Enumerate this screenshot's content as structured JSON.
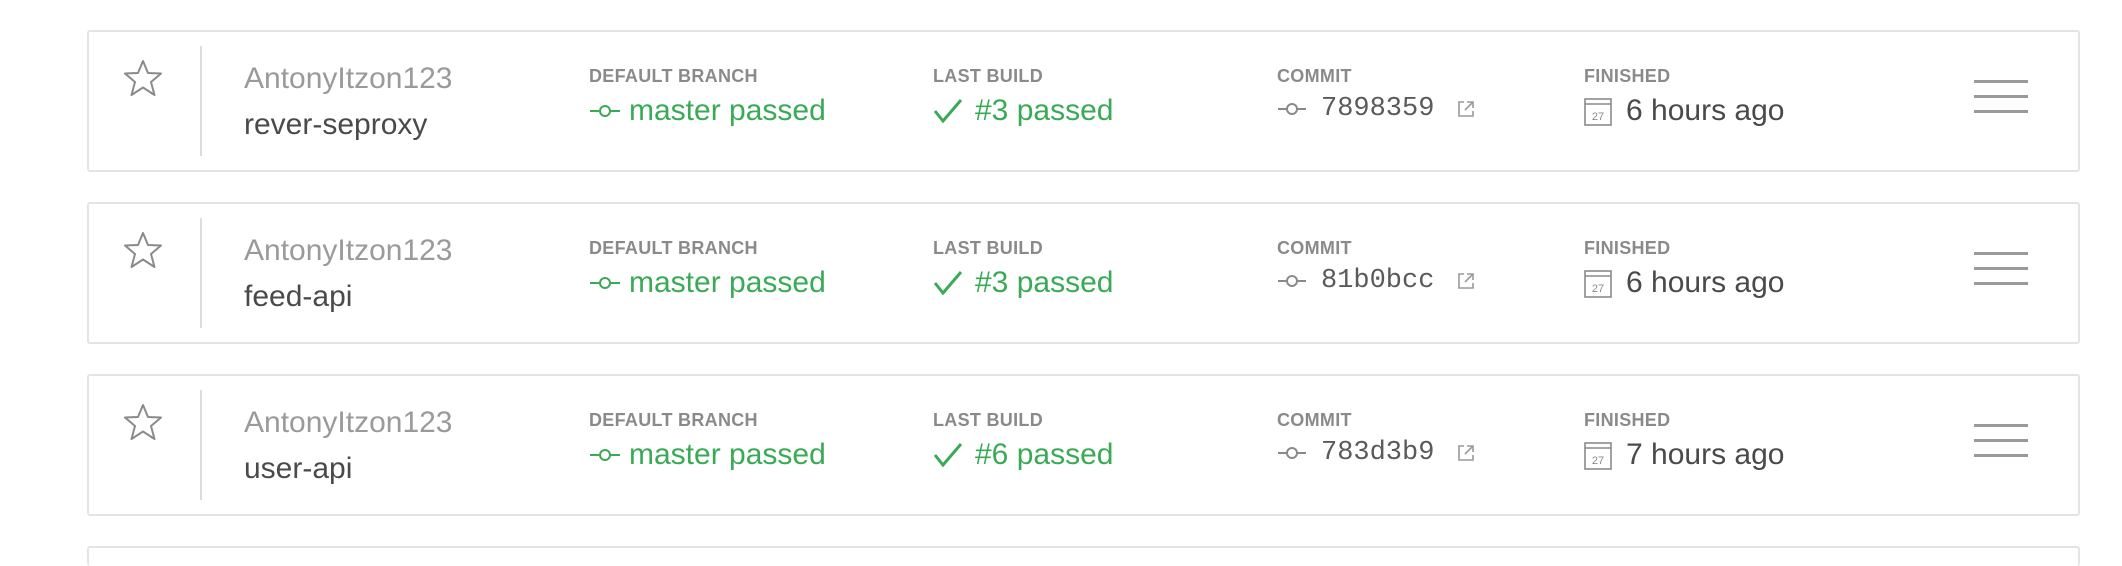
{
  "repos": [
    {
      "owner": "AntonyItzon123",
      "name": "rever-seproxy",
      "branch_label": "DEFAULT BRANCH",
      "branch_value": "master passed",
      "build_label": "LAST BUILD",
      "build_value": "#3 passed",
      "commit_label": "COMMIT",
      "commit_value": "7898359",
      "finished_label": "FINISHED",
      "calendar_day": "27",
      "finished_value": "6 hours ago"
    },
    {
      "owner": "AntonyItzon123",
      "name": "feed-api",
      "branch_label": "DEFAULT BRANCH",
      "branch_value": "master passed",
      "build_label": "LAST BUILD",
      "build_value": "#3 passed",
      "commit_label": "COMMIT",
      "commit_value": "81b0bcc",
      "finished_label": "FINISHED",
      "calendar_day": "27",
      "finished_value": "6 hours ago"
    },
    {
      "owner": "AntonyItzon123",
      "name": "user-api",
      "branch_label": "DEFAULT BRANCH",
      "branch_value": "master passed",
      "build_label": "LAST BUILD",
      "build_value": "#6 passed",
      "commit_label": "COMMIT",
      "commit_value": "783d3b9",
      "finished_label": "FINISHED",
      "calendar_day": "27",
      "finished_value": "7 hours ago"
    }
  ],
  "icons": {
    "star": "star-icon",
    "branch": "branch-icon",
    "check": "check-icon",
    "commit": "commit-icon",
    "external_link": "external-link-icon",
    "calendar": "calendar-icon",
    "menu": "hamburger-menu-icon"
  },
  "colors": {
    "passed": "#39aa56",
    "border": "#e4e4e4",
    "muted_text": "#9a9a9a",
    "body_text": "#4a4a4a"
  }
}
